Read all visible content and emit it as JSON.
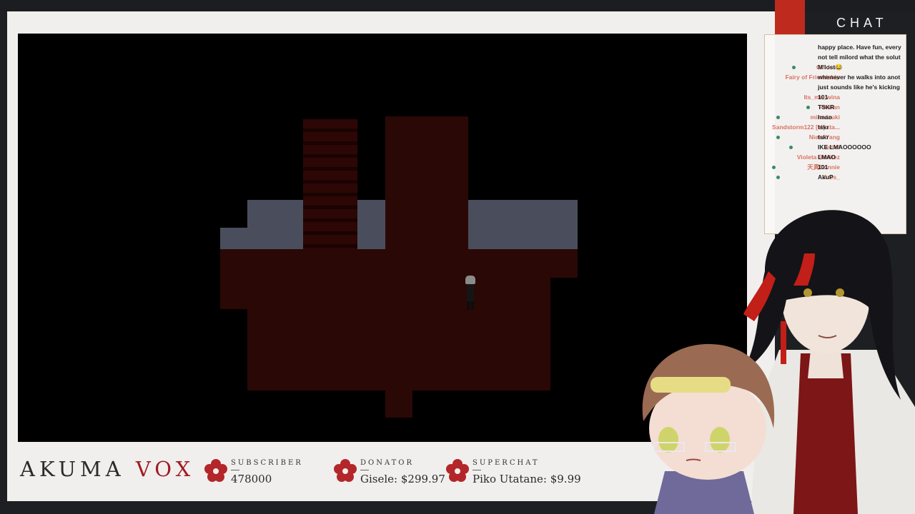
{
  "brand": {
    "name_part1": "AKUMA",
    "name_part2": "VOX"
  },
  "stats": [
    {
      "label": "SUBSCRIBER",
      "value": "478000"
    },
    {
      "label": "DONATOR",
      "value": "Gisele: $299.97"
    },
    {
      "label": "SUPERCHAT",
      "value": "Piko Utatane: $9.99"
    }
  ],
  "chat": {
    "title": "CHAT",
    "messages": [
      {
        "name": "",
        "text": "happy place. Have fun, every"
      },
      {
        "name": "",
        "text": "not tell milord what the solut"
      },
      {
        "name": "Coldsea",
        "text": "M'lost😂"
      },
      {
        "name": "Fairy of Friendship",
        "text": "whenever he walks into anot"
      },
      {
        "name": "",
        "text": "just sounds like he's kicking"
      },
      {
        "name": "Its_me_wina",
        "text": "101"
      },
      {
        "name": "Phoran",
        "text": "TSKR"
      },
      {
        "name": "minadzuki",
        "text": "lmao"
      },
      {
        "name": "Sandstorm122 [Mysta...",
        "text": "tskr"
      },
      {
        "name": "Nielu Yang",
        "text": "tskr"
      },
      {
        "name": "astiel",
        "text": "IKE LMAOOOOOO"
      },
      {
        "name": "Violeta Benitez",
        "text": "LMAO"
      },
      {
        "name": "天真Connie",
        "text": "101"
      },
      {
        "name": "Ares_",
        "text": "AkuP"
      }
    ]
  },
  "colors": {
    "accent": "#a01b22",
    "chat_red": "#bf2a1f",
    "floor": "#2a0806",
    "wall": "#4a4e5c"
  }
}
